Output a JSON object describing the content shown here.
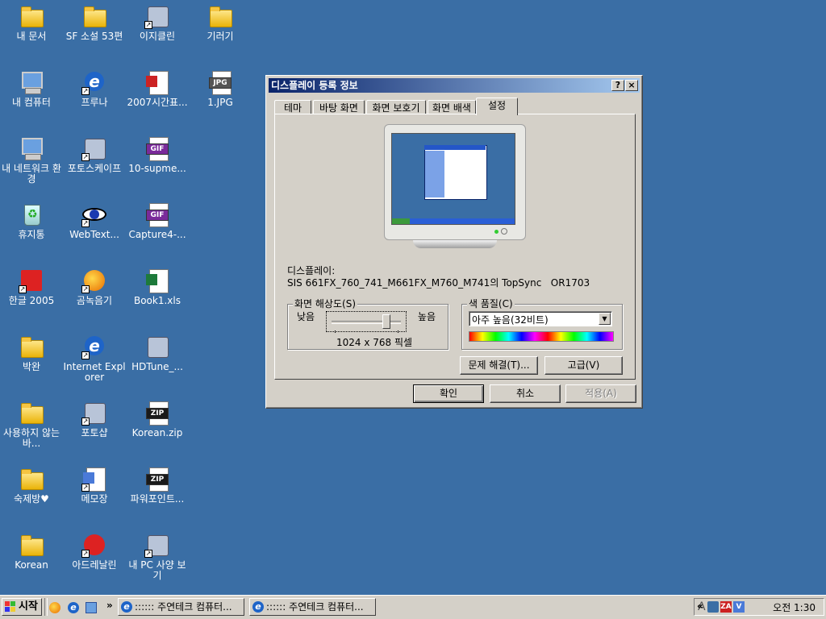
{
  "desktop": {
    "icons": [
      {
        "label": "내 문서",
        "icon": "my-documents-icon"
      },
      {
        "label": "SF 소설 53편",
        "icon": "folder-icon"
      },
      {
        "label": "이지클린",
        "icon": "ezclean-icon"
      },
      {
        "label": "기러기",
        "icon": "folder-icon"
      },
      {
        "label": "내 컴퓨터",
        "icon": "my-computer-icon"
      },
      {
        "label": "프루나",
        "icon": "pruna-icon"
      },
      {
        "label": "2007시간표...",
        "icon": "pdf-file-icon"
      },
      {
        "label": "1.JPG",
        "icon": "jpg-file-icon",
        "badge": "JPG"
      },
      {
        "label": "내 네트워크 환경",
        "icon": "network-icon"
      },
      {
        "label": "포토스케이프",
        "icon": "photoscape-icon"
      },
      {
        "label": "10-supme...",
        "icon": "gif-file-icon",
        "badge": "GIF"
      },
      {
        "label": "휴지통",
        "icon": "recycle-bin-icon"
      },
      {
        "label": "WebText...",
        "icon": "eye-icon"
      },
      {
        "label": "Capture4-...",
        "icon": "gif-file-icon",
        "badge": "GIF"
      },
      {
        "label": "한글 2005",
        "icon": "hangul-icon"
      },
      {
        "label": "곰녹음기",
        "icon": "gom-recorder-icon"
      },
      {
        "label": "Book1.xls",
        "icon": "excel-file-icon"
      },
      {
        "label": "박완",
        "icon": "folder-icon"
      },
      {
        "label": "Internet Explorer",
        "icon": "internet-explorer-icon"
      },
      {
        "label": "HDTune_...",
        "icon": "hdtune-icon"
      },
      {
        "label": "사용하지 않는 바...",
        "icon": "folder-icon"
      },
      {
        "label": "포토샵",
        "icon": "photoshop-icon"
      },
      {
        "label": "Korean.zip",
        "icon": "zip-file-icon",
        "badge": "ZIP"
      },
      {
        "label": "숙제방♥",
        "icon": "folder-icon"
      },
      {
        "label": "메모장",
        "icon": "notepad-icon"
      },
      {
        "label": "파워포인트...",
        "icon": "zip-file-icon",
        "badge": "ZIP"
      },
      {
        "label": "Korean",
        "icon": "folder-icon"
      },
      {
        "label": "아드레날린",
        "icon": "adrenaline-icon"
      },
      {
        "label": "내 PC 사양 보기",
        "icon": "pc-spec-icon"
      }
    ]
  },
  "dialog": {
    "title": "디스플레이 등록 정보",
    "help_btn": "?",
    "close_btn": "×",
    "tabs": [
      "테마",
      "바탕 화면",
      "화면 보호기",
      "화면 배색",
      "설정"
    ],
    "active_tab": "설정",
    "display_label": "디스플레이:",
    "display_value": "SIS 661FX_760_741_M661FX_M760_M741의 TopSync   OR1703",
    "resolution": {
      "group_label": "화면 해상도(S)",
      "low": "낮음",
      "high": "높음",
      "value_text": "1024 x 768 픽셀",
      "slider_level": 0.85
    },
    "color": {
      "group_label": "색 품질(C)",
      "selected": "아주 높음(32비트)"
    },
    "troubleshoot_btn": "문제 해결(T)...",
    "advanced_btn": "고급(V)",
    "ok_btn": "확인",
    "cancel_btn": "취소",
    "apply_btn": "적용(A)"
  },
  "taskbar": {
    "start_label": "시작",
    "chevron": "»",
    "tasks": [
      ":::::: 주연테크 컴퓨터...",
      ":::::: 주연테크 컴퓨터..."
    ],
    "tray_lang": "A",
    "tray_chevron": "«",
    "clock": "오전 1:30"
  },
  "colors": {
    "desktop": "#3a6ea5",
    "titlebar": "#0a246a",
    "face": "#d4d0c8"
  }
}
